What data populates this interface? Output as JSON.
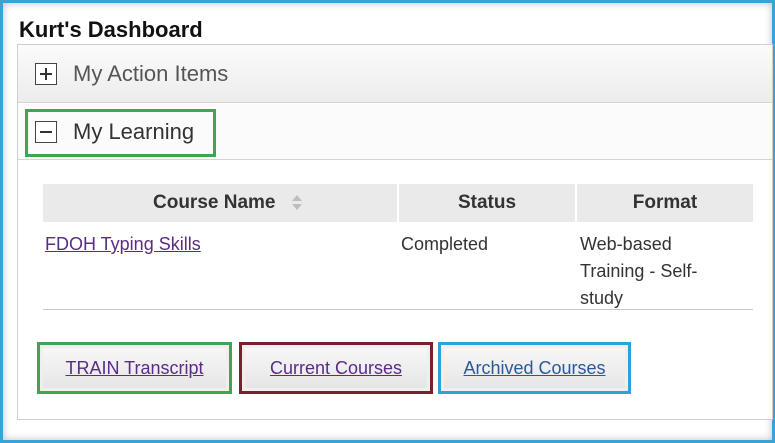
{
  "dashboard": {
    "title": "Kurt's Dashboard"
  },
  "sections": {
    "action_items": {
      "label": "My Action Items",
      "state": "collapsed"
    },
    "learning": {
      "label": "My Learning",
      "state": "expanded"
    }
  },
  "table": {
    "columns": [
      "Course Name",
      "Status",
      "Format"
    ],
    "rows": [
      {
        "course": "FDOH Typing Skills",
        "status": "Completed",
        "format_lines": [
          "Web-based",
          "Training - Self-",
          "study"
        ]
      }
    ]
  },
  "buttons": {
    "train_transcript": "TRAIN Transcript",
    "current_courses": "Current Courses",
    "archived_courses": "Archived Courses"
  },
  "colors": {
    "frame_border": "#3aa3d6",
    "highlight_green": "#3ca653",
    "highlight_maroon": "#7a1f2b",
    "highlight_blue": "#2aa3d8",
    "link": "#5a2d82"
  },
  "icons": {
    "expand": "plus-icon",
    "collapse": "minus-icon",
    "sort": "sort-icon"
  }
}
